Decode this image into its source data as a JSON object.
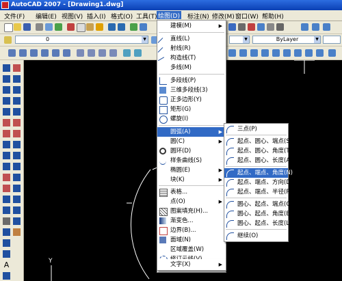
{
  "titlebar": {
    "title": "AutoCAD 2007 - [Drawing1.dwg]"
  },
  "menubar": [
    {
      "label": "文件(F)"
    },
    {
      "label": "编辑(E)"
    },
    {
      "label": "视图(V)"
    },
    {
      "label": "插入(I)"
    },
    {
      "label": "格式(O)"
    },
    {
      "label": "工具(T)"
    },
    {
      "label": "绘图(D)"
    },
    {
      "label": "标注(N)"
    },
    {
      "label": "修改(M)"
    },
    {
      "label": "窗口(W)"
    },
    {
      "label": "帮助(H)"
    }
  ],
  "toolbar": {
    "layer_value": "0",
    "linetype_value": "ByLayer",
    "linetype_value2": "ByLayer"
  },
  "draw_menu": {
    "items": [
      {
        "label": "建模(M)",
        "submenu": true
      },
      {
        "label": "直线(L)"
      },
      {
        "label": "射线(R)"
      },
      {
        "label": "构造线(T)"
      },
      {
        "label": "多线(M)"
      },
      {
        "label": "多段线(P)"
      },
      {
        "label": "三维多段线(3)"
      },
      {
        "label": "正多边形(Y)"
      },
      {
        "label": "矩形(G)"
      },
      {
        "label": "螺旋(I)"
      },
      {
        "label": "圆弧(A)",
        "submenu": true
      },
      {
        "label": "圆(C)",
        "submenu": true
      },
      {
        "label": "圆环(D)"
      },
      {
        "label": "样条曲线(S)"
      },
      {
        "label": "椭圆(E)",
        "submenu": true
      },
      {
        "label": "块(K)",
        "submenu": true
      },
      {
        "label": "表格..."
      },
      {
        "label": "点(O)",
        "submenu": true
      },
      {
        "label": "图案填充(H)..."
      },
      {
        "label": "渐变色..."
      },
      {
        "label": "边界(B)..."
      },
      {
        "label": "面域(N)"
      },
      {
        "label": "区域覆盖(W)"
      },
      {
        "label": "修订云线(V)"
      },
      {
        "label": "文字(X)",
        "submenu": true
      }
    ]
  },
  "arc_submenu": {
    "items": [
      {
        "label": "三点(P)"
      },
      {
        "label": "起点、圆心、端点(S)"
      },
      {
        "label": "起点、圆心、角度(T)"
      },
      {
        "label": "起点、圆心、长度(A)"
      },
      {
        "label": "起点、端点、角度(N)"
      },
      {
        "label": "起点、端点、方向(D)"
      },
      {
        "label": "起点、端点、半径(R)"
      },
      {
        "label": "圆心、起点、端点(C)"
      },
      {
        "label": "圆心、起点、角度(E)"
      },
      {
        "label": "圆心、起点、长度(L)"
      },
      {
        "label": "继续(O)"
      }
    ]
  },
  "ucs": {
    "y_label": "Y"
  },
  "colors": {
    "highlight": "#316ac5",
    "chrome": "#ece9d8",
    "canvas": "#000000"
  }
}
